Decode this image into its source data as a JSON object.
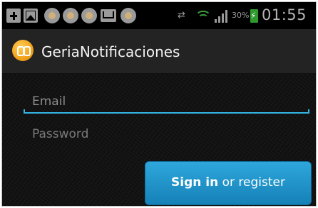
{
  "status_bar": {
    "notification_icons": [
      "plus-icon",
      "image-icon",
      "app-icon",
      "app-icon",
      "app-icon",
      "gmail-icon",
      "app-icon"
    ],
    "battery_percent": "30%",
    "time": "01:55"
  },
  "action_bar": {
    "title": "GeriaNotificaciones"
  },
  "form": {
    "email_placeholder": "Email",
    "password_placeholder": "Password",
    "submit_primary": "Sign in",
    "submit_secondary": " or register"
  },
  "colors": {
    "accent": "#33b5e5",
    "button": "#1e94cc",
    "background": "#101010"
  }
}
